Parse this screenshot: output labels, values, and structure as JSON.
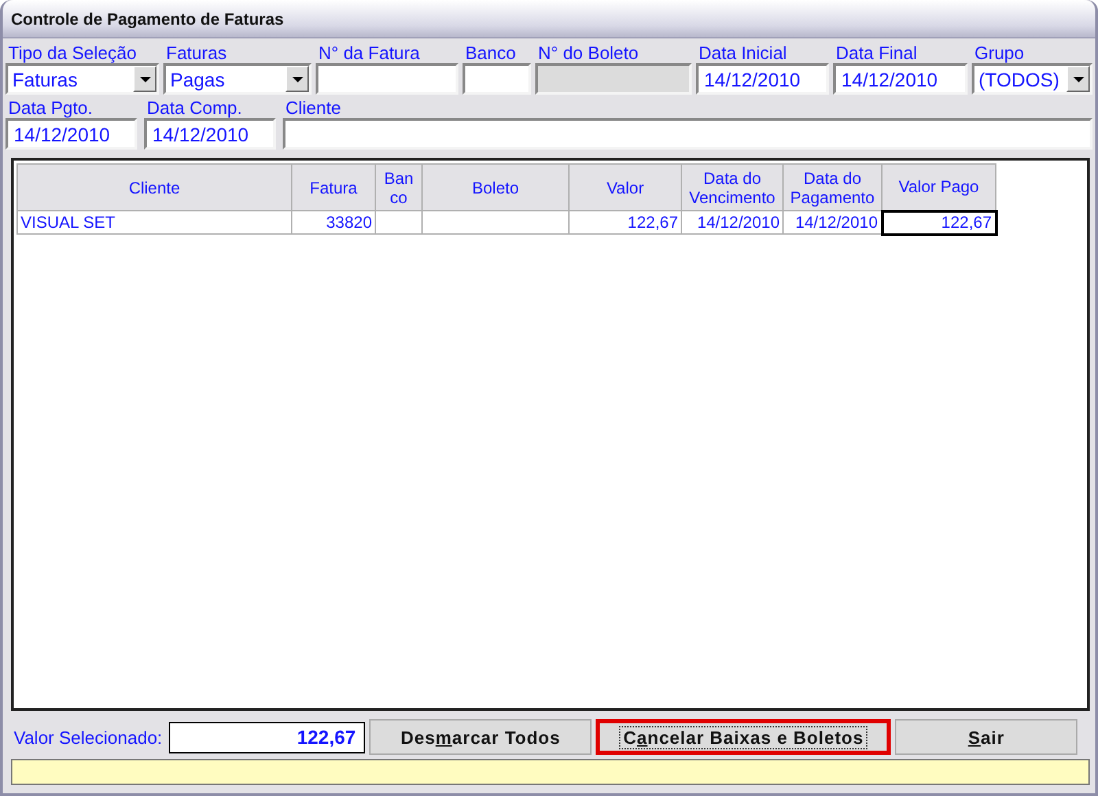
{
  "window": {
    "title": "Controle de Pagamento de Faturas"
  },
  "filters": [
    {
      "label": "Tipo da Seleção",
      "kind": "combo",
      "value": "Faturas",
      "disabled": false
    },
    {
      "label": "Faturas",
      "kind": "combo",
      "value": "Pagas",
      "disabled": false
    },
    {
      "label": "N° da Fatura",
      "kind": "text",
      "disabled": false
    },
    {
      "label": "Banco",
      "kind": "text",
      "disabled": false
    },
    {
      "label": "N° do Boleto",
      "kind": "text",
      "disabled": true
    },
    {
      "label": "Data Inicial",
      "kind": "text",
      "value": "14/12/2010",
      "disabled": false
    },
    {
      "label": "Data Final",
      "kind": "text",
      "value": "14/12/2010",
      "disabled": false
    },
    {
      "label": "Grupo",
      "kind": "combo",
      "value": "(TODOS)",
      "disabled": false
    }
  ],
  "filters_2": [
    {
      "label": "Data Pgto.",
      "kind": "text",
      "value": "14/12/2010",
      "disabled": false
    },
    {
      "label": "Data Comp.",
      "kind": "text",
      "value": "14/12/2010",
      "disabled": false
    },
    {
      "label": "Cliente",
      "kind": "text",
      "disabled": false
    }
  ],
  "table": {
    "columns": [
      "Cliente",
      "Fatura",
      "Ban co",
      "Boleto",
      "Valor",
      "Data do Vencimento",
      "Data do Pagamento",
      "Valor Pago"
    ],
    "rows": [
      {
        "cells": [
          {
            "text": "VISUAL SET",
            "focused": false
          },
          {
            "text": "33820",
            "focused": false
          },
          {
            "focused": false
          },
          {
            "focused": false
          },
          {
            "text": "122,67",
            "focused": false
          },
          {
            "text": "14/12/2010",
            "focused": false
          },
          {
            "text": "14/12/2010",
            "focused": false
          },
          {
            "text": "122,67",
            "focused": true
          }
        ]
      }
    ]
  },
  "footer": {
    "total_label": "Valor Selecionado:",
    "total_value": "122,67",
    "buttons": [
      {
        "prefix": "Des",
        "mnemonic": "m",
        "suffix": "arcar Todos",
        "highlighted": false,
        "focused": false
      },
      {
        "prefix": "C",
        "mnemonic": "a",
        "suffix": "ncelar Baixas e Boletos",
        "highlighted": true,
        "focused": true
      },
      {
        "mnemonic": "S",
        "suffix": "air",
        "highlighted": false,
        "focused": false
      }
    ]
  }
}
